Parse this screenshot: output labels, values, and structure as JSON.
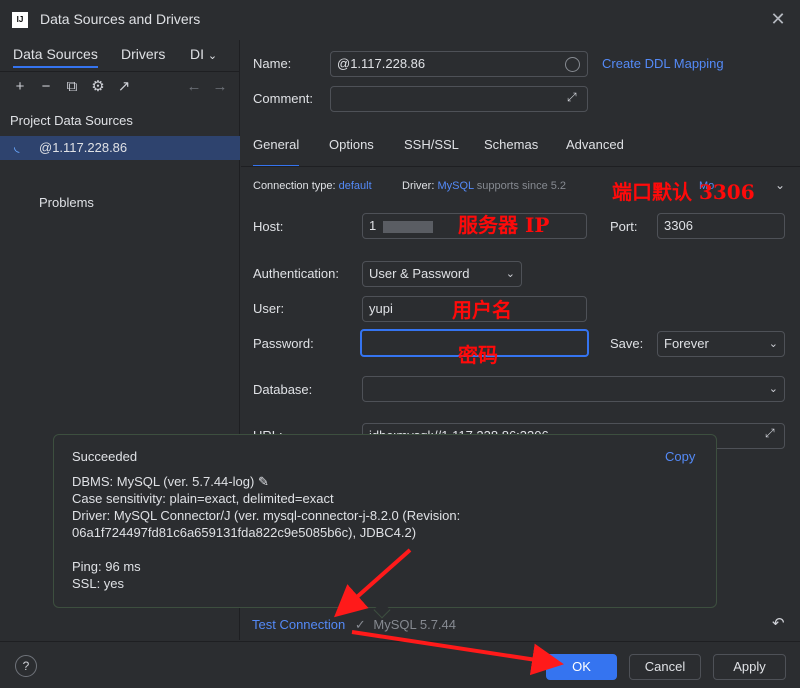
{
  "window": {
    "title": "Data Sources and Drivers",
    "logo": "IJ"
  },
  "left": {
    "tabs": [
      "Data Sources",
      "Drivers",
      "DI"
    ],
    "section_title": "Project Data Sources",
    "selected_source": "@1.117.228.86",
    "problems": "Problems"
  },
  "form": {
    "name_label": "Name:",
    "name_value": "@1.117.228.86",
    "create_ddl": "Create DDL Mapping",
    "comment_label": "Comment:",
    "tabs": [
      "General",
      "Options",
      "SSH/SSL",
      "Schemas",
      "Advanced"
    ],
    "conn_type_label": "Connection type:",
    "conn_type_value": "default",
    "driver_label": "Driver:",
    "driver_value": "MySQL",
    "driver_note": "supports since 5.2",
    "more": "Mo",
    "host_label": "Host:",
    "host_value": "1",
    "port_label": "Port:",
    "port_value": "3306",
    "auth_label": "Authentication:",
    "auth_value": "User & Password",
    "user_label": "User:",
    "user_value": "yupi",
    "password_label": "Password:",
    "password_value": "",
    "save_label": "Save:",
    "save_value": "Forever",
    "database_label": "Database:",
    "url_label": "URL:",
    "url_value": "jdbc:mysql://1.117.228.86:3306"
  },
  "annotations": {
    "port": "端口默认 3306",
    "server": "服务器 IP",
    "user": "用户名",
    "password": "密码"
  },
  "popup": {
    "status": "Succeeded",
    "copy": "Copy",
    "dbms": "DBMS: MySQL (ver. 5.7.44-log)",
    "case": "Case sensitivity: plain=exact, delimited=exact",
    "driver1": "Driver: MySQL Connector/J (ver. mysql-connector-j-8.2.0 (Revision:",
    "driver2": "06a1f724497fd81c6a659131fda822c9e5085b6c), JDBC4.2)",
    "ping": "Ping: 96 ms",
    "ssl": "SSL: yes"
  },
  "footer": {
    "test_connection": "Test Connection",
    "version": "MySQL 5.7.44",
    "ok": "OK",
    "cancel": "Cancel",
    "apply": "Apply",
    "help": "?"
  }
}
